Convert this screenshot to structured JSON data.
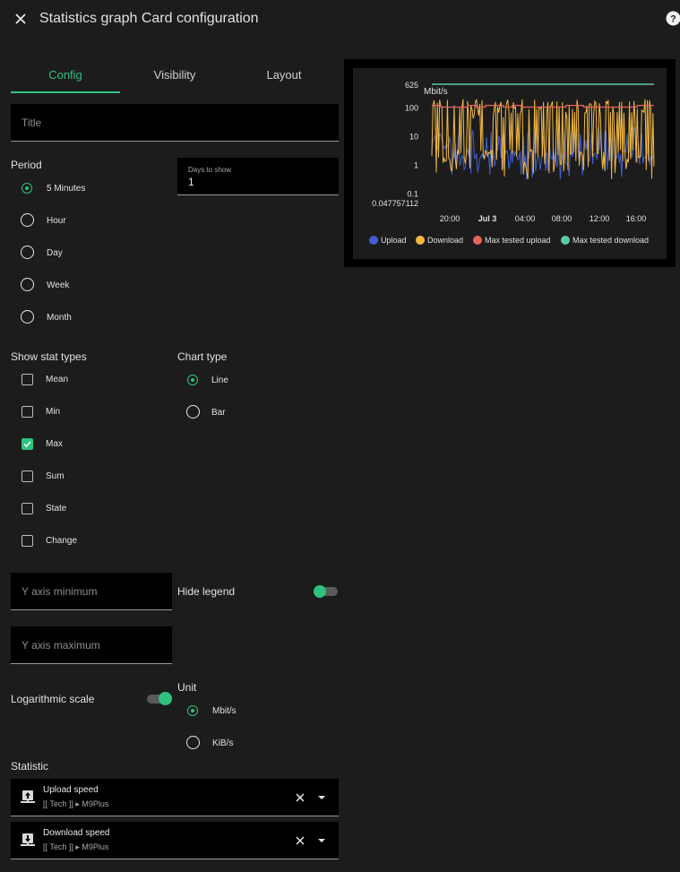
{
  "header": {
    "title": "Statistics graph Card configuration"
  },
  "tabs": [
    {
      "label": "Config"
    },
    {
      "label": "Visibility"
    },
    {
      "label": "Layout"
    }
  ],
  "form": {
    "title_placeholder": "Title",
    "period_label": "Period",
    "periods": [
      "5 Minutes",
      "Hour",
      "Day",
      "Week",
      "Month"
    ],
    "period_selected": "5 Minutes",
    "days_label": "Days to show",
    "days_value": "1",
    "stat_types_label": "Show stat types",
    "stat_types": [
      {
        "label": "Mean",
        "checked": false
      },
      {
        "label": "Min",
        "checked": false
      },
      {
        "label": "Max",
        "checked": true
      },
      {
        "label": "Sum",
        "checked": false
      },
      {
        "label": "State",
        "checked": false
      },
      {
        "label": "Change",
        "checked": false
      }
    ],
    "chart_type_label": "Chart type",
    "chart_types": [
      "Line",
      "Bar"
    ],
    "chart_type_selected": "Line",
    "y_min_placeholder": "Y axis minimum",
    "y_max_placeholder": "Y axis maximum",
    "hide_legend_label": "Hide legend",
    "hide_legend_on": false,
    "log_scale_label": "Logarithmic scale",
    "log_scale_on": true,
    "unit_label": "Unit",
    "units": [
      "Mbit/s",
      "KiB/s"
    ],
    "unit_selected": "Mbit/s",
    "statistic_label": "Statistic",
    "statistics": [
      {
        "name": "Upload speed",
        "sub": "[[ Tech ]] ▸ M9Plus",
        "icon": "upload-icon"
      },
      {
        "name": "Download speed",
        "sub": "[[ Tech ]] ▸ M9Plus",
        "icon": "download-icon"
      }
    ]
  },
  "colors": {
    "accent": "#2ec27e",
    "upload": "#3f5fd2",
    "download": "#f4b942",
    "max_upload": "#e8635a",
    "max_download": "#5cc9a7"
  },
  "chart_data": {
    "type": "line",
    "unit_label": "Mbit/s",
    "y_scale": "log",
    "ylim": [
      0.047757112,
      625
    ],
    "y_ticks": [
      "625",
      "100",
      "10",
      "1",
      "0.1"
    ],
    "y_min_label": "0.047757112",
    "x_ticks": [
      "20:00",
      "Jul 3",
      "04:00",
      "08:00",
      "12:00",
      "16:00"
    ],
    "grid": false,
    "legend_position": "bottom",
    "series": [
      {
        "name": "Upload",
        "color": "#3f5fd2"
      },
      {
        "name": "Download",
        "color": "#f4b942"
      },
      {
        "name": "Max tested upload",
        "color": "#e8635a",
        "value": 100
      },
      {
        "name": "Max tested download",
        "color": "#5cc9a7",
        "value": 625
      }
    ]
  }
}
